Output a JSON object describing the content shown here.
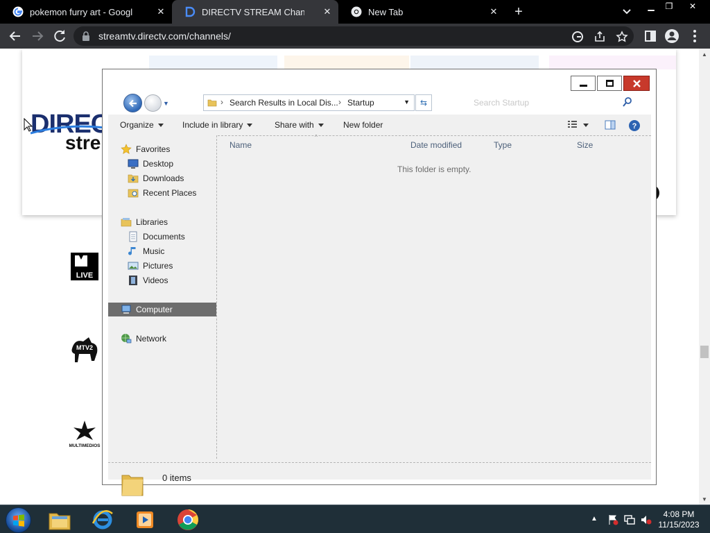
{
  "browser": {
    "tabs": [
      {
        "title": "pokemon furry art - Google Sear",
        "favicon": "google-icon",
        "active": false
      },
      {
        "title": "DIRECTV STREAM Channel Lineu",
        "favicon": "directv-icon",
        "active": true
      },
      {
        "title": "New Tab",
        "favicon": "chrome-icon",
        "active": false
      }
    ],
    "new_tab_label": "+",
    "url": "streamtv.directv.com/channels/"
  },
  "page": {
    "logo_line1": "DIREC",
    "logo_line2": "stre",
    "channels": [
      {
        "name": "MTV LIVE",
        "icon": "mtv-live-logo"
      },
      {
        "name": "MTV2",
        "icon": "mtv2-logo"
      },
      {
        "name": "MULTIMEDIOS",
        "icon": "multimedios-logo"
      }
    ]
  },
  "explorer": {
    "breadcrumb": [
      "Search Results in Local Dis...",
      "Startup"
    ],
    "search_placeholder": "Search Startup",
    "commands": {
      "organize": "Organize",
      "include_in_library": "Include in library",
      "share_with": "Share with",
      "new_folder": "New folder"
    },
    "nav": {
      "favorites": "Favorites",
      "desktop": "Desktop",
      "downloads": "Downloads",
      "recent_places": "Recent Places",
      "libraries": "Libraries",
      "documents": "Documents",
      "music": "Music",
      "pictures": "Pictures",
      "videos": "Videos",
      "computer": "Computer",
      "network": "Network"
    },
    "columns": {
      "name": "Name",
      "date_modified": "Date modified",
      "type": "Type",
      "size": "Size"
    },
    "empty_message": "This folder is empty.",
    "item_count": "0 items"
  },
  "taskbar": {
    "apps": [
      "windows-explorer",
      "internet-explorer",
      "media-player",
      "google-chrome"
    ],
    "time": "4:08 PM",
    "date": "11/15/2023"
  },
  "colors": {
    "chrome_tabstrip": "#000000",
    "chrome_toolbar": "#35363a",
    "explorer_selected": "#6d6d6d",
    "taskbar": "#1f2f38",
    "close_button": "#c7392b"
  }
}
